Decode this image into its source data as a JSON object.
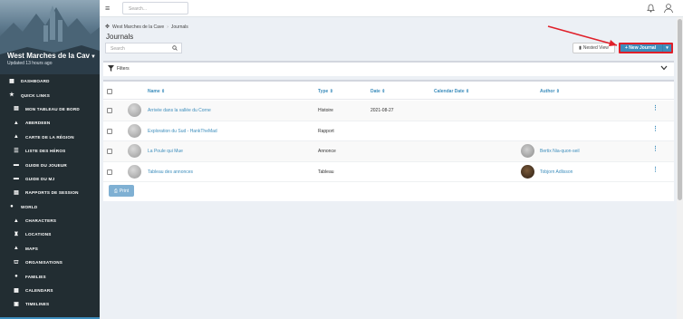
{
  "topbar": {
    "search_placeholder": "Search..."
  },
  "campaign": {
    "name": "West Marches de la Cav",
    "updated": "Updated 13 hours ago"
  },
  "sidebar": {
    "items": [
      {
        "label": "Dashboard",
        "icon": "dashboard-icon",
        "level": 0
      },
      {
        "label": "Quick Links",
        "icon": "star-icon",
        "level": 0
      },
      {
        "label": "Mon tableau de bord",
        "icon": "board-icon",
        "level": 1
      },
      {
        "label": "Aberdeen",
        "icon": "map-pin-icon",
        "level": 1
      },
      {
        "label": "Carte de la région",
        "icon": "map-icon",
        "level": 1
      },
      {
        "label": "Liste des héros",
        "icon": "list-icon",
        "level": 1
      },
      {
        "label": "Guide du joueur",
        "icon": "book-icon",
        "level": 1
      },
      {
        "label": "Guide du MJ",
        "icon": "book-icon",
        "level": 1
      },
      {
        "label": "Rapports de session",
        "icon": "report-icon",
        "level": 1
      },
      {
        "label": "World",
        "icon": "globe-icon",
        "level": 0
      },
      {
        "label": "Characters",
        "icon": "user-icon",
        "level": 1
      },
      {
        "label": "Locations",
        "icon": "tower-icon",
        "level": 1
      },
      {
        "label": "Maps",
        "icon": "map-icon",
        "level": 1
      },
      {
        "label": "Organisations",
        "icon": "org-icon",
        "level": 1
      },
      {
        "label": "Families",
        "icon": "family-icon",
        "level": 1
      },
      {
        "label": "Calendars",
        "icon": "calendar-icon",
        "level": 1
      },
      {
        "label": "Timelines",
        "icon": "timeline-icon",
        "level": 1
      }
    ]
  },
  "breadcrumb": {
    "campaign": "West Marches de la Cave",
    "current": "Journals"
  },
  "page": {
    "title": "Journals"
  },
  "list": {
    "search_placeholder": "Search",
    "nested_view": "Nested View",
    "new_journal": "+ New Journal",
    "filters": "Filters",
    "print": "Print"
  },
  "table": {
    "headers": {
      "name": "Name ⇕",
      "type": "Type ⇕",
      "date": "Date ⇕",
      "calendar_date": "Calendar Date ⇕",
      "author": "Author ⇕"
    },
    "rows": [
      {
        "name": "Arrivée dans la vallée du Corne",
        "type": "Histoire",
        "date": "2021-08-27",
        "author": ""
      },
      {
        "name": "Exploration du Sud - HankTheMad",
        "type": "Rapport",
        "date": "",
        "author": ""
      },
      {
        "name": "La Poule qui Mue",
        "type": "Annonce",
        "date": "",
        "author": "Bertix Nia-quon-seil"
      },
      {
        "name": "Tableau des annonces",
        "type": "Tableau",
        "date": "",
        "author": "Tobjorn Adlisson"
      }
    ]
  },
  "colors": {
    "accent": "#3c8dbc",
    "sidebar_bg": "#222d32",
    "highlight": "#e0202a"
  }
}
